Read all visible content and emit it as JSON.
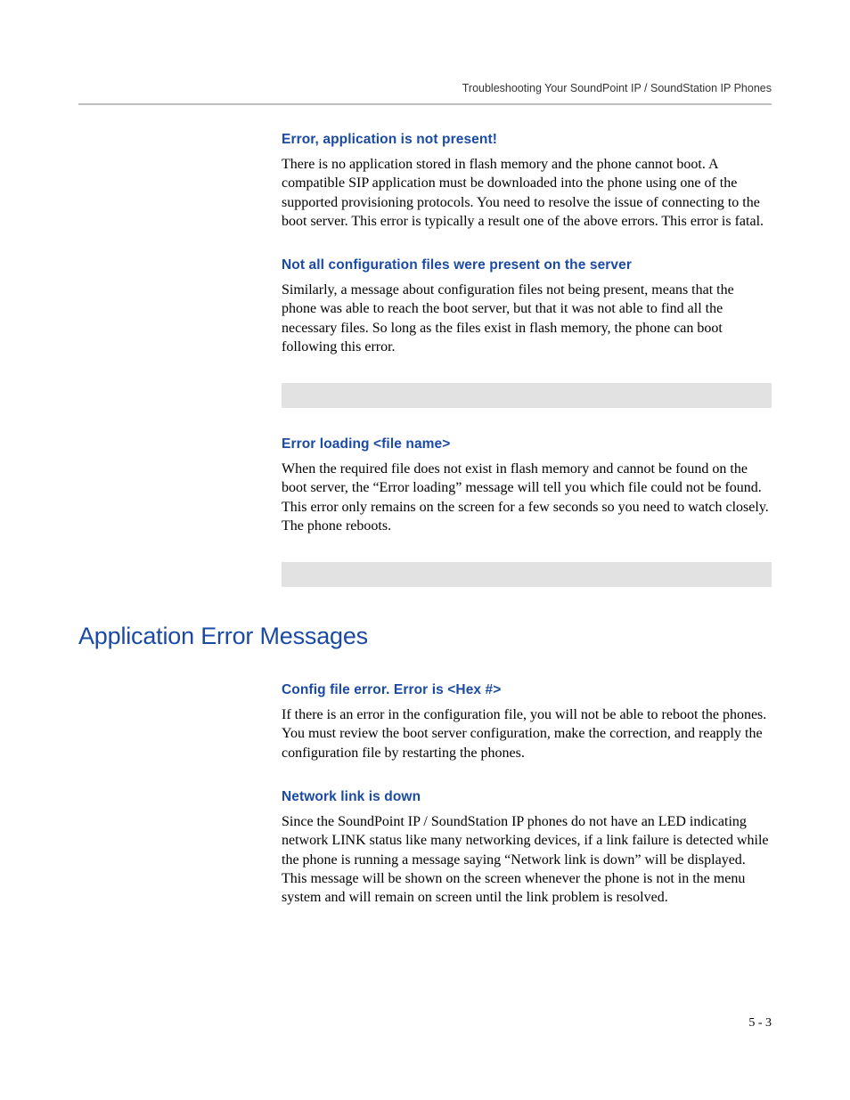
{
  "header": {
    "running_title": "Troubleshooting Your SoundPoint IP / SoundStation IP Phones"
  },
  "sections": {
    "s1": {
      "heading": "Error, application is not present!",
      "body": "There is no application stored in flash memory and the phone cannot boot. A compatible SIP application must be downloaded into the phone using one of the supported provisioning protocols. You need to resolve the issue of connecting to the boot server. This error is typically a result one of the above errors. This error is fatal."
    },
    "s2": {
      "heading": "Not all configuration files were present on the server",
      "body": "Similarly, a message about configuration files not being present, means that the phone was able to reach the boot server, but that it was not able to find all the necessary files. So long as the files exist in flash memory, the phone can boot following this error."
    },
    "s3": {
      "heading": "Error loading <file name>",
      "body": "When the required file does not exist in flash memory and cannot be found on the boot server, the “Error loading” message will tell you which file could not be found. This error only remains on the screen for a few seconds so you need to watch closely. The phone reboots."
    },
    "main_heading": "Application Error Messages",
    "s4": {
      "heading": "Config file error. Error is <Hex #>",
      "body": "If there is an error in the configuration file, you will not be able to reboot the phones. You must review the boot server configuration, make the correction, and reapply the configuration file by restarting the phones."
    },
    "s5": {
      "heading": "Network link is down",
      "body": "Since the SoundPoint IP / SoundStation IP phones do not have an LED indicating network LINK status like many networking devices, if a link failure is detected while the phone is running a message saying “Network link is down” will be displayed. This message will be shown on the screen whenever the phone is not in the menu system and will remain on screen until the link problem is resolved."
    }
  },
  "footer": {
    "page_number": "5 - 3"
  }
}
